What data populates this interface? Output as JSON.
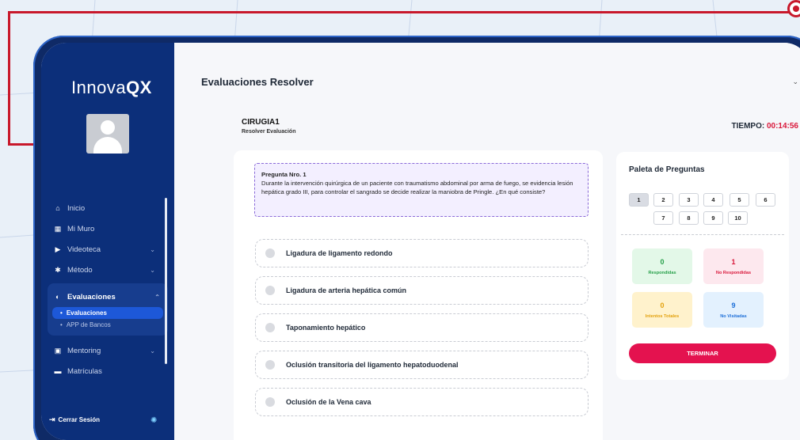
{
  "sidebar": {
    "logo_text": "Innova",
    "logo_bold": "QX",
    "items": [
      {
        "label": "Inicio",
        "icon": "home-icon"
      },
      {
        "label": "Mi Muro",
        "icon": "grid-icon"
      },
      {
        "label": "Videoteca",
        "icon": "video-icon"
      },
      {
        "label": "Método",
        "icon": "method-icon"
      }
    ],
    "group": {
      "label": "Evaluaciones",
      "icon": "evaluation-icon",
      "subitems": [
        {
          "label": "Evaluaciones",
          "active": true
        },
        {
          "label": "APP de Bancos",
          "active": false
        }
      ]
    },
    "items_after": [
      {
        "label": "Mentoring",
        "icon": "mentoring-icon"
      },
      {
        "label": "Matrículas",
        "icon": "enrollment-icon"
      }
    ],
    "logout_label": "Cerrar Sesión"
  },
  "header": {
    "title": "Evaluaciones Resolver"
  },
  "exam": {
    "title": "CIRUGIA1",
    "subtitle": "Resolver Evaluación",
    "timer_label": "TIEMPO:",
    "timer_value": "00:14:56"
  },
  "question": {
    "number_label": "Pregunta Nro. 1",
    "text": "Durante la intervención quirúrgica de un paciente con traumatismo abdominal por arma de fuego, se evidencia lesión hepática grado III, para controlar el sangrado se decide realizar la maniobra de Pringle. ¿En qué consiste?",
    "options": [
      "Ligadura de ligamento redondo",
      "Ligadura de arteria hepática común",
      "Taponamiento hepático",
      "Oclusión transitoria del ligamento hepatoduodenal",
      "Oclusión de la Vena cava"
    ]
  },
  "palette": {
    "title": "Paleta de Preguntas",
    "numbers": [
      "1",
      "2",
      "3",
      "4",
      "5",
      "6",
      "7",
      "8",
      "9",
      "10"
    ],
    "current": "1",
    "stats": {
      "respondidas": {
        "value": "0",
        "label": "Respondidas"
      },
      "no_respondidas": {
        "value": "1",
        "label": "No Respondidas"
      },
      "intentos": {
        "value": "0",
        "label": "Intentos Totales"
      },
      "no_visitadas": {
        "value": "9",
        "label": "No Visitadas"
      }
    },
    "finish_label": "TERMINAR"
  },
  "colors": {
    "sidebar_bg": "#0c2f7a",
    "accent_red": "#e4124f",
    "timer_red": "#d9183b"
  }
}
